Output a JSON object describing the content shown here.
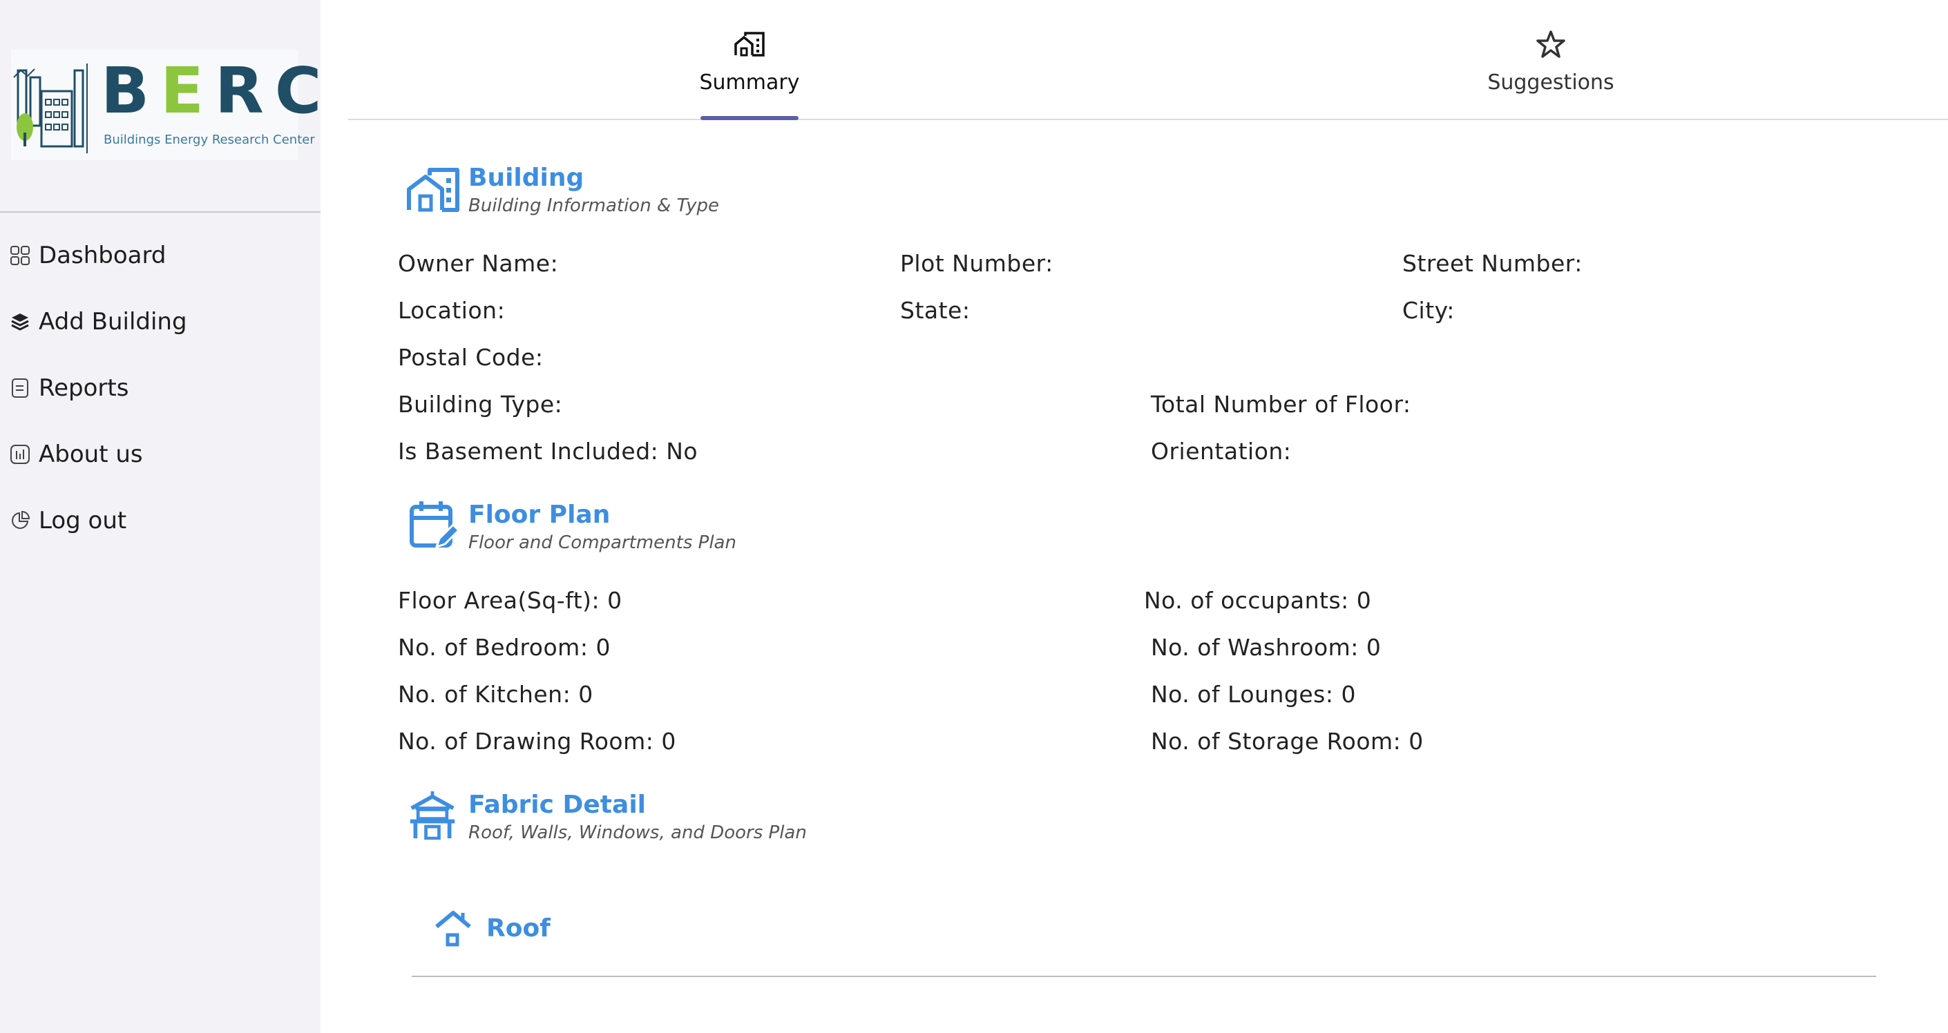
{
  "logo": {
    "brand": "BERC",
    "brand_parts": [
      "B",
      "E",
      "RC"
    ],
    "tagline": "Buildings Energy Research Center",
    "colors": {
      "primary": "#1f4e66",
      "accent": "#8cc63f"
    }
  },
  "sidebar": {
    "items": [
      {
        "label": "Dashboard",
        "icon": "grid-icon"
      },
      {
        "label": "Add Building",
        "icon": "stack-icon"
      },
      {
        "label": "Reports",
        "icon": "document-icon"
      },
      {
        "label": "About us",
        "icon": "chart-icon"
      },
      {
        "label": "Log out",
        "icon": "pie-icon"
      }
    ]
  },
  "tabs": [
    {
      "label": "Summary",
      "icon": "building-icon",
      "active": true
    },
    {
      "label": "Suggestions",
      "icon": "star-icon",
      "active": false
    }
  ],
  "sections": {
    "building": {
      "title": "Building",
      "subtitle": "Building Information & Type",
      "fields": {
        "owner_name": "Owner Name:",
        "plot_number": "Plot Number:",
        "street_number": "Street Number:",
        "location": "Location:",
        "state": "State:",
        "city": "City:",
        "postal_code": "Postal Code:",
        "building_type": "Building Type:",
        "total_floors": "Total Number of Floor:",
        "basement": "Is Basement Included: No",
        "orientation": "Orientation:"
      }
    },
    "floor_plan": {
      "title": "Floor Plan",
      "subtitle": "Floor and Compartments Plan",
      "fields": {
        "floor_area": "Floor Area(Sq-ft): 0",
        "occupants": "No. of occupants: 0",
        "bedroom": "No. of Bedroom: 0",
        "washroom": "No. of Washroom: 0",
        "kitchen": "No. of Kitchen: 0",
        "lounges": "No. of Lounges: 0",
        "drawing_room": "No. of Drawing Room: 0",
        "storage_room": "No. of Storage Room: 0"
      }
    },
    "fabric_detail": {
      "title": "Fabric Detail",
      "subtitle": "Roof, Walls, Windows, and Doors Plan",
      "roof_label": "Roof"
    }
  },
  "colors": {
    "accent_blue": "#3d8ee0",
    "tab_indicator": "#5c5fa6",
    "sidebar_bg": "#f3f3f7"
  }
}
